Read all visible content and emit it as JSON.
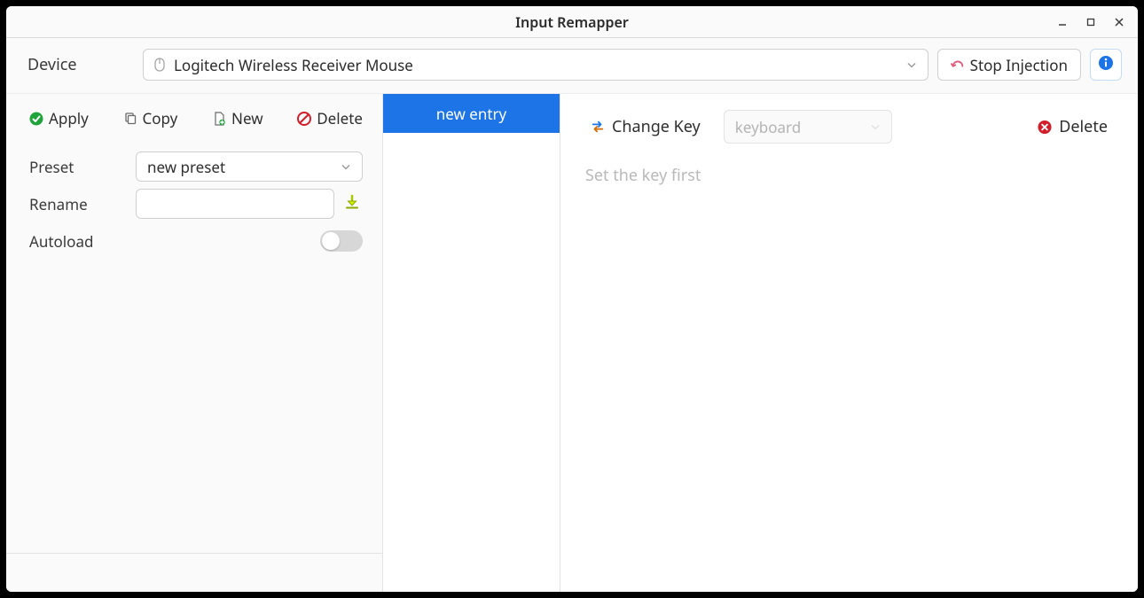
{
  "title": "Input Remapper",
  "device": {
    "label": "Device",
    "selected": "Logitech Wireless Receiver Mouse",
    "stop_label": "Stop Injection"
  },
  "left": {
    "apply": "Apply",
    "copy": "Copy",
    "new": "New",
    "delete": "Delete",
    "preset_label": "Preset",
    "preset_selected": "new preset",
    "rename_label": "Rename",
    "rename_value": "",
    "autoload_label": "Autoload",
    "autoload_on": false
  },
  "mid": {
    "entry_label": "new entry"
  },
  "right": {
    "change_key": "Change Key",
    "mode_placeholder": "keyboard",
    "delete": "Delete",
    "body_placeholder": "Set the key first"
  }
}
